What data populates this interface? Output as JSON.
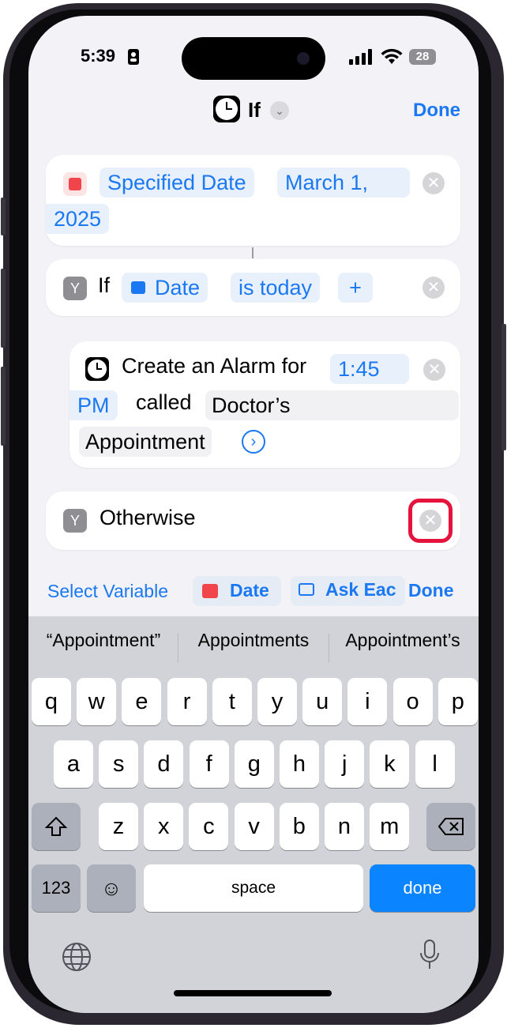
{
  "status": {
    "time": "5:39",
    "battery": "28"
  },
  "nav": {
    "title": "If",
    "done": "Done"
  },
  "date_card": {
    "chip1": "Specified Date",
    "chip2": "March 1,",
    "chip3": "2025"
  },
  "if_card": {
    "label": "If",
    "var": "Date",
    "cond": "is today",
    "plus": "+"
  },
  "alarm_card": {
    "prefix": "Create an Alarm for",
    "time1": "1:45",
    "time2": "PM",
    "called": "called",
    "name1": "Doctor’s",
    "name2": "Appointment"
  },
  "otherwise_card": {
    "label": "Otherwise"
  },
  "toolbar": {
    "select": "Select Variable",
    "date": "Date",
    "ask": "Ask Eac",
    "done": "Done"
  },
  "suggestions": [
    "“Appointment”",
    "Appointments",
    "Appointment’s"
  ],
  "keyboard": {
    "row1": [
      "q",
      "w",
      "e",
      "r",
      "t",
      "y",
      "u",
      "i",
      "o",
      "p"
    ],
    "row2": [
      "a",
      "s",
      "d",
      "f",
      "g",
      "h",
      "j",
      "k",
      "l"
    ],
    "row3": [
      "z",
      "x",
      "c",
      "v",
      "b",
      "n",
      "m"
    ],
    "num": "123",
    "space": "space",
    "done": "done"
  },
  "colors": {
    "accent": "#1a78f2",
    "highlight": "#e5143c",
    "calendar": "#f0454a"
  }
}
